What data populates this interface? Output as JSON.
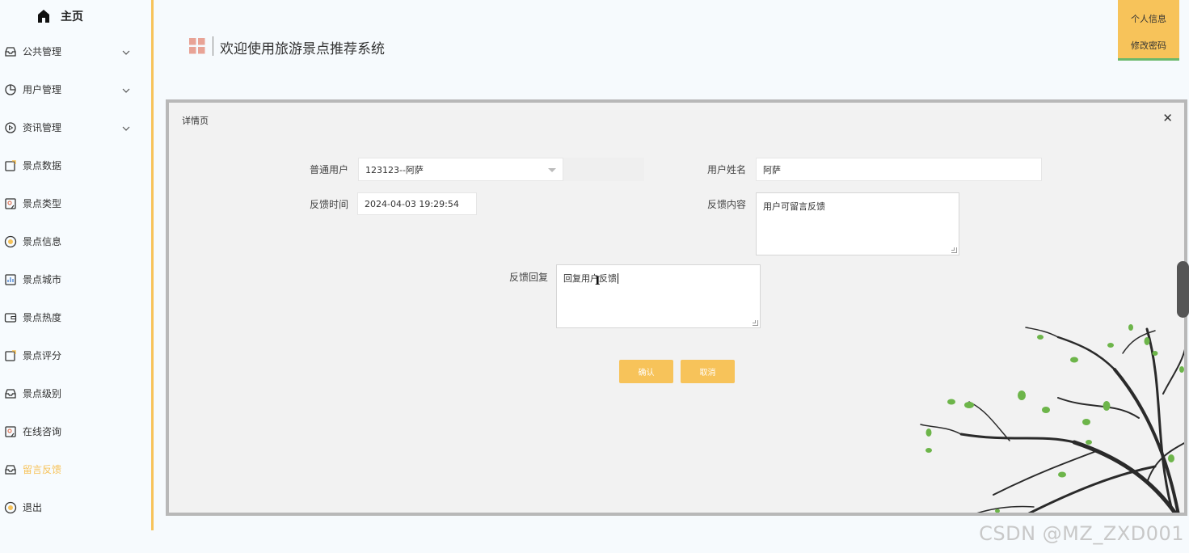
{
  "sidebar": {
    "home": "主页",
    "items": [
      {
        "label": "公共管理",
        "icon": "inbox-icon",
        "expandable": true
      },
      {
        "label": "用户管理",
        "icon": "pie-chart-icon",
        "expandable": true
      },
      {
        "label": "资讯管理",
        "icon": "play-circle-icon",
        "expandable": true
      },
      {
        "label": "景点数据",
        "icon": "edit-icon",
        "expandable": false
      },
      {
        "label": "景点类型",
        "icon": "bookmark-icon",
        "expandable": false
      },
      {
        "label": "景点信息",
        "icon": "sun-icon",
        "expandable": false
      },
      {
        "label": "景点城市",
        "icon": "bar-chart-icon",
        "expandable": false
      },
      {
        "label": "景点热度",
        "icon": "wallet-icon",
        "expandable": false
      },
      {
        "label": "景点评分",
        "icon": "edit-icon",
        "expandable": false
      },
      {
        "label": "景点级别",
        "icon": "inbox-icon",
        "expandable": false
      },
      {
        "label": "在线咨询",
        "icon": "bookmark-icon",
        "expandable": false
      },
      {
        "label": "留言反馈",
        "icon": "inbox-icon",
        "expandable": false,
        "active": true
      },
      {
        "label": "退出",
        "icon": "sun-icon",
        "expandable": false
      }
    ]
  },
  "header": {
    "title": "欢迎使用旅游景点推荐系统",
    "user_menu": [
      "个人信息",
      "修改密码"
    ]
  },
  "dialog": {
    "title": "详情页",
    "fields": {
      "user_label": "普通用户",
      "user_value": "123123--阿萨",
      "name_label": "用户姓名",
      "name_value": "阿萨",
      "time_label": "反馈时间",
      "time_value": "2024-04-03 19:29:54",
      "content_label": "反馈内容",
      "content_value": "用户可留言反馈",
      "reply_label": "反馈回复",
      "reply_value": "回复用户反馈"
    },
    "buttons": {
      "confirm": "确认",
      "cancel": "取消"
    }
  },
  "watermark": "CSDN @MZ_ZXD001",
  "colors": {
    "accent": "#f7c35a",
    "active_menu": "#f7c35a",
    "dialog_bg": "#f2f2f2"
  }
}
